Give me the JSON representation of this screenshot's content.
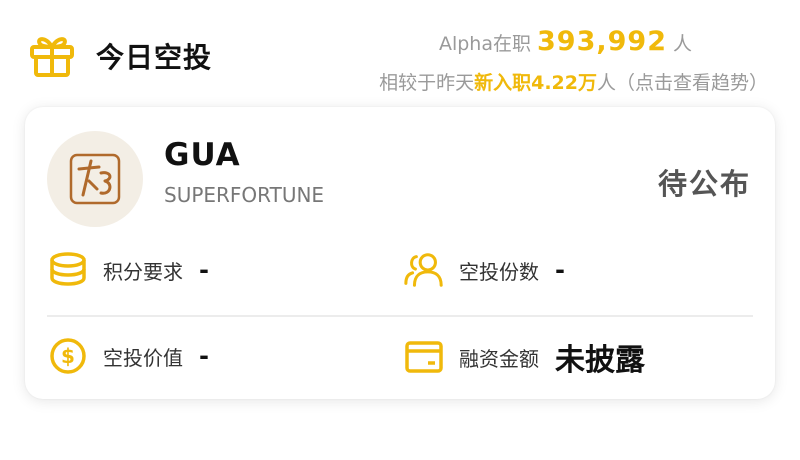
{
  "header": {
    "title": "今日空投",
    "stats": {
      "prefix": "Alpha在职",
      "count": "393,992",
      "suffix": "人",
      "compare_prefix": "相较于昨天",
      "compare_highlight": "新入职4.22万",
      "compare_suffix": "人（点击查看趋势）"
    }
  },
  "airdrop": {
    "symbol": "GUA",
    "name": "SUPERFORTUNE",
    "status": "待公布",
    "fields": {
      "points_label": "积分要求",
      "points_value": "-",
      "shares_label": "空投份数",
      "shares_value": "-",
      "value_label": "空投价值",
      "value_value": "-",
      "funding_label": "融资金额",
      "funding_value": "未披露"
    }
  },
  "colors": {
    "accent": "#f0b90b",
    "logo_brown": "#b06a2c"
  },
  "icons": [
    "gift-icon",
    "token-logo",
    "coins-stack-icon",
    "users-icon",
    "dollar-circle-icon",
    "wallet-icon"
  ]
}
